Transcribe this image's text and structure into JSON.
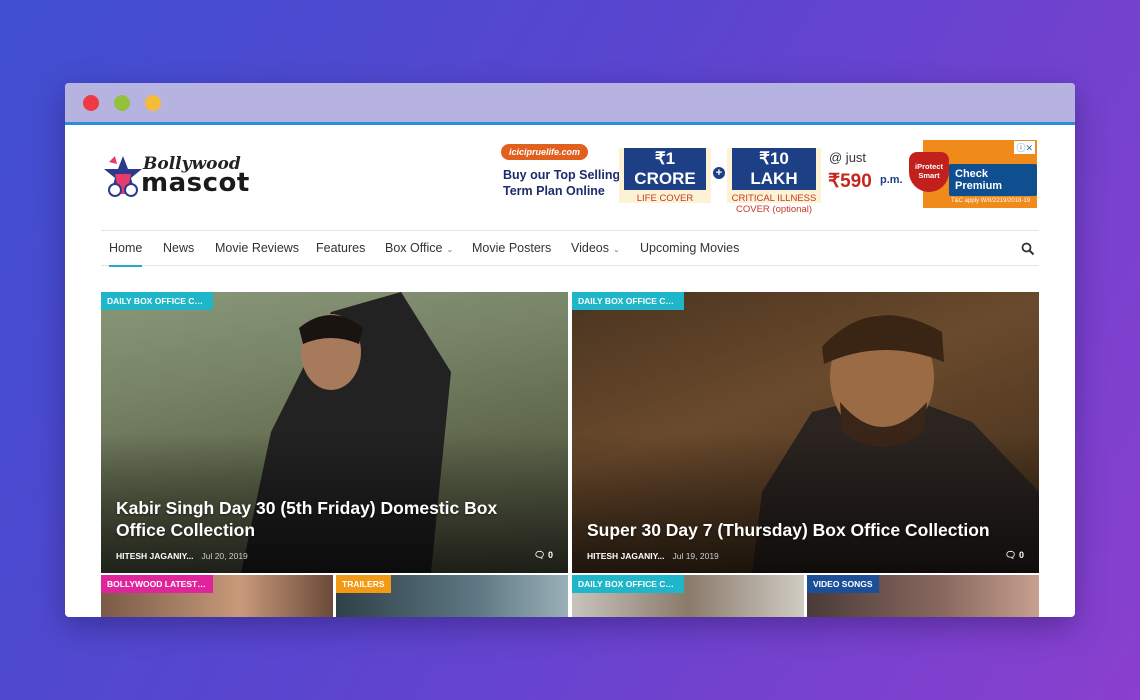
{
  "site": {
    "logo_top": "Bollywood",
    "logo_main": "mascot"
  },
  "ad": {
    "badge": "icicipruelife.com",
    "line1": "Buy our Top Selling",
    "line2": "Term Plan Online",
    "crore_head": "₹1 CRORE",
    "crore_sub": "LIFE COVER",
    "lakh_head": "₹10 LAKH",
    "lakh_sub1": "CRITICAL ILLNESS",
    "lakh_sub2": "COVER (optional)",
    "at": "@ just",
    "price": "₹590",
    "per": "p.m.",
    "shield": "iProtect Smart",
    "cta": "Check Premium",
    "fine": "T&C apply W/II/2219/2018-19"
  },
  "nav": {
    "items": [
      {
        "label": "Home"
      },
      {
        "label": "News"
      },
      {
        "label": "Movie Reviews"
      },
      {
        "label": "Features"
      },
      {
        "label": "Box Office"
      },
      {
        "label": "Movie Posters"
      },
      {
        "label": "Videos"
      },
      {
        "label": "Upcoming Movies"
      }
    ]
  },
  "featured": [
    {
      "category": "DAILY BOX OFFICE COLL...",
      "category_color": "#20b6c9",
      "title": "Kabir Singh Day 30 (5th Friday) Domestic Box Office Collection",
      "author": "HITESH JAGANIY...",
      "date": "Jul 20, 2019",
      "comments": "0"
    },
    {
      "category": "DAILY BOX OFFICE COLL...",
      "category_color": "#20b6c9",
      "title": "Super 30 Day 7 (Thursday) Box Office Collection",
      "author": "HITESH JAGANIY...",
      "date": "Jul 19, 2019",
      "comments": "0"
    }
  ],
  "small_cards": [
    {
      "category": "BOLLYWOOD LATEST N...",
      "category_color": "#e0259c"
    },
    {
      "category": "TRAILERS",
      "category_color": "#f29a16"
    },
    {
      "category": "DAILY BOX OFFICE COLL...",
      "category_color": "#20b6c9"
    },
    {
      "category": "VIDEO SONGS",
      "category_color": "#1d4f99"
    }
  ]
}
